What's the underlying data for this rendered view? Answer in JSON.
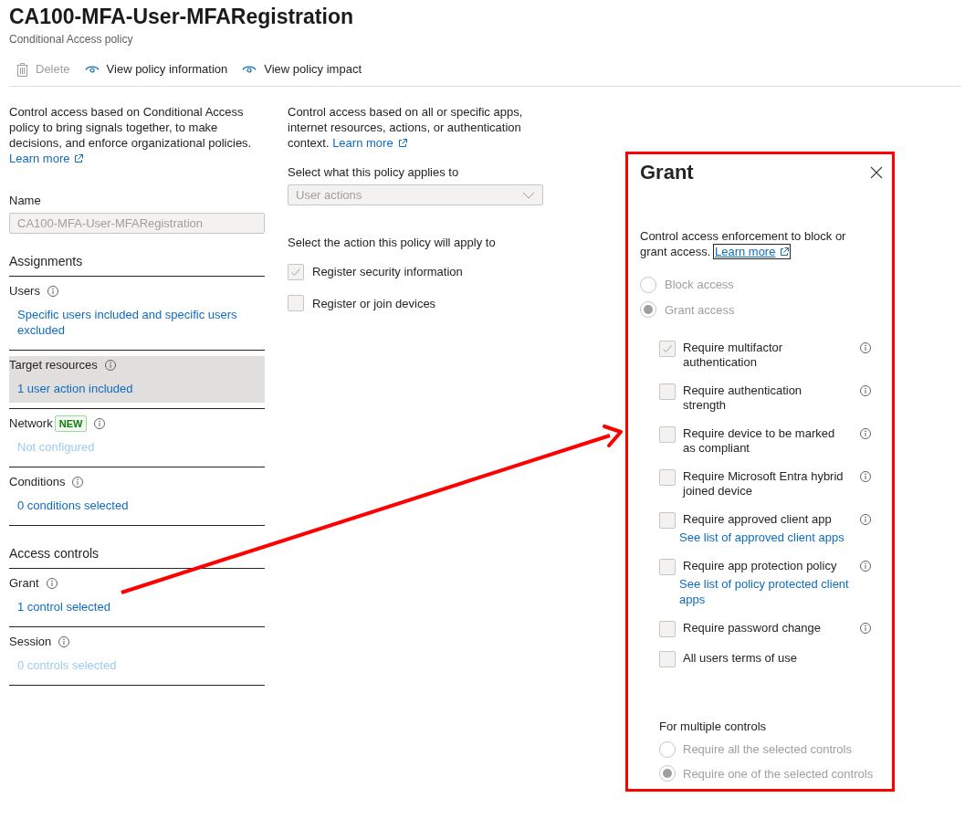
{
  "header": {
    "title": "CA100-MFA-User-MFARegistration",
    "subtitle": "Conditional Access policy"
  },
  "toolbar": [
    {
      "kind": "trash",
      "label": "Delete",
      "disabled": true
    },
    {
      "kind": "eye",
      "label": "View policy information",
      "disabled": false
    },
    {
      "kind": "eye",
      "label": "View policy impact",
      "disabled": false
    }
  ],
  "left": {
    "intro": "Control access based on Conditional Access policy to bring signals together, to make decisions, and enforce organizational policies.",
    "learn_more": "Learn more",
    "name_label": "Name",
    "name_value": "CA100-MFA-User-MFARegistration",
    "sections": [
      {
        "heading": "Assignments",
        "items": [
          {
            "label": "Users",
            "value": "Specific users included and specific users excluded",
            "dimmed": false,
            "selected": false
          },
          {
            "label": "Target resources",
            "value": "1 user action included",
            "dimmed": false,
            "selected": true
          },
          {
            "label": "Network",
            "badge": "NEW",
            "value": "Not configured",
            "dimmed": true,
            "selected": false
          },
          {
            "label": "Conditions",
            "value": "0 conditions selected",
            "dimmed": false,
            "selected": false
          }
        ]
      },
      {
        "heading": "Access controls",
        "items": [
          {
            "label": "Grant",
            "value": "1 control selected",
            "dimmed": false,
            "selected": false
          },
          {
            "label": "Session",
            "value": "0 controls selected",
            "dimmed": true,
            "selected": false
          }
        ]
      }
    ]
  },
  "middle": {
    "intro": "Control access based on all or specific apps, internet resources, actions, or authentication context.",
    "learn_more": "Learn more",
    "applies_label": "Select what this policy applies to",
    "applies_value": "User actions",
    "actions_label": "Select the action this policy will apply to",
    "actions": [
      {
        "label": "Register security information",
        "checked": true
      },
      {
        "label": "Register or join devices",
        "checked": false
      }
    ]
  },
  "grant_panel": {
    "title": "Grant",
    "intro": "Control access enforcement to block or grant access.",
    "learn_more": "Learn more",
    "learn_more_focused": true,
    "access_options": [
      {
        "label": "Block access",
        "selected": false
      },
      {
        "label": "Grant access",
        "selected": true
      }
    ],
    "controls": [
      {
        "label": "Require multifactor authentication",
        "checked": true,
        "info": true
      },
      {
        "label": "Require authentication strength",
        "checked": false,
        "info": true
      },
      {
        "label": "Require device to be marked as compliant",
        "checked": false,
        "info": true
      },
      {
        "label": "Require Microsoft Entra hybrid joined device",
        "checked": false,
        "info": true
      },
      {
        "label": "Require approved client app",
        "checked": false,
        "info": true,
        "link": "See list of approved client apps"
      },
      {
        "label": "Require app protection policy",
        "checked": false,
        "info": true,
        "link": "See list of policy protected client apps"
      },
      {
        "label": "Require password change",
        "checked": false,
        "info": true
      },
      {
        "label": "All users terms of use",
        "checked": false,
        "info": false
      }
    ],
    "multiple_label": "For multiple controls",
    "multiple_options": [
      {
        "label": "Require all the selected controls",
        "selected": false
      },
      {
        "label": "Require one of the selected controls",
        "selected": true
      }
    ]
  }
}
